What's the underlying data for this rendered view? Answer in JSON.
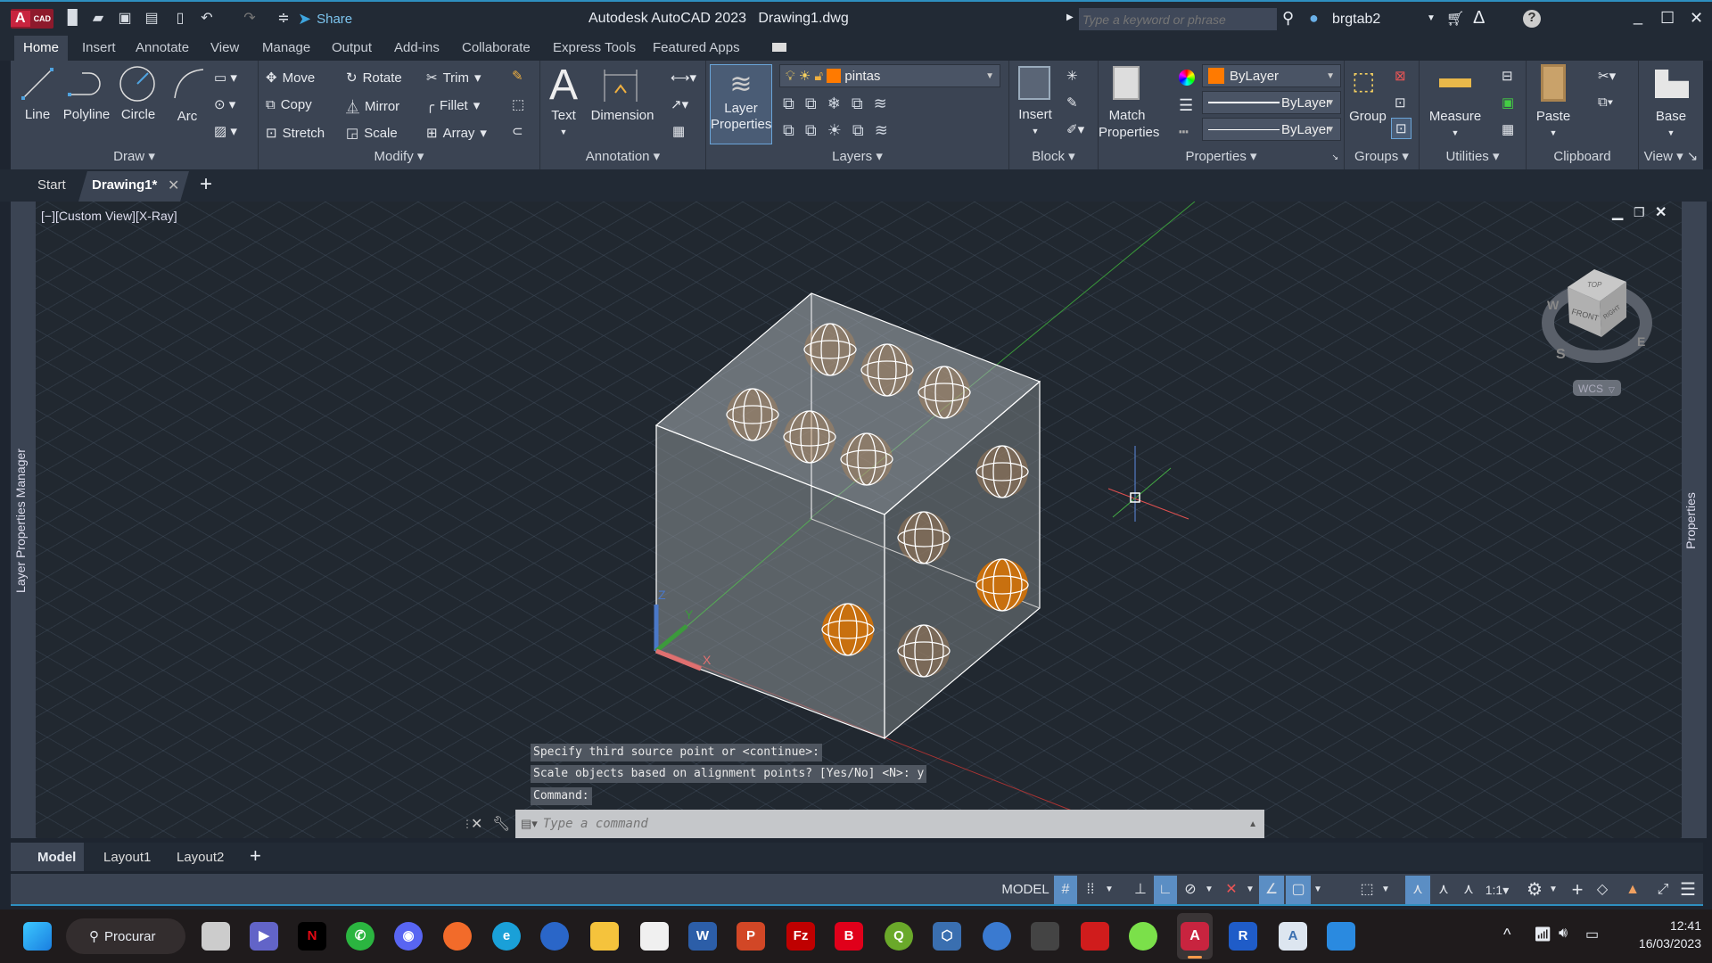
{
  "titlebar": {
    "app_logo": "A CAD",
    "share": "Share",
    "title": "Autodesk AutoCAD 2023",
    "file": "Drawing1.dwg",
    "search_placeholder": "Type a keyword or phrase",
    "user": "brgtab2"
  },
  "ribbon_tabs": [
    "Home",
    "Insert",
    "Annotate",
    "View",
    "Manage",
    "Output",
    "Add-ins",
    "Collaborate",
    "Express Tools",
    "Featured Apps"
  ],
  "ribbon": {
    "draw": {
      "label": "Draw",
      "tools": [
        "Line",
        "Polyline",
        "Circle",
        "Arc"
      ]
    },
    "modify": {
      "label": "Modify",
      "tools": [
        "Move",
        "Rotate",
        "Trim",
        "Copy",
        "Mirror",
        "Fillet",
        "Stretch",
        "Scale",
        "Array"
      ]
    },
    "annotation": {
      "label": "Annotation",
      "tools": [
        "Text",
        "Dimension"
      ]
    },
    "layers": {
      "label": "Layers",
      "layer_properties": "Layer",
      "layer_properties2": "Properties",
      "current_layer": "pintas",
      "layer_color": "#ff7a00"
    },
    "block": {
      "label": "Block",
      "insert": "Insert"
    },
    "properties": {
      "label": "Properties",
      "match1": "Match",
      "match2": "Properties",
      "color": "ByLayer",
      "linetype": "ByLayer",
      "lineweight": "ByLayer"
    },
    "groups": {
      "label": "Groups",
      "group": "Group"
    },
    "utilities": {
      "label": "Utilities",
      "measure": "Measure"
    },
    "clipboard": {
      "label": "Clipboard",
      "paste": "Paste"
    },
    "view": {
      "label": "View",
      "base": "Base"
    }
  },
  "doc_tabs": {
    "start": "Start",
    "active": "Drawing1*"
  },
  "viewport": {
    "label": "[−][Custom View][X-Ray]",
    "viewcube": {
      "top": "TOP",
      "front": "FRONT",
      "right": "RIGHT",
      "n": "N",
      "w": "W",
      "s": "S",
      "e": "E",
      "ucs": "WCS"
    },
    "ucs_axes": {
      "x": "X",
      "y": "Y",
      "z": "Z"
    }
  },
  "side_palettes": {
    "left": "Layer Properties Manager",
    "right": "Properties"
  },
  "command": {
    "history": [
      "Specify third source point or <continue>:",
      "Scale objects based on alignment points? [Yes/No] <N>: y",
      "Command:"
    ],
    "placeholder": "Type a command"
  },
  "layout_tabs": [
    "Model",
    "Layout1",
    "Layout2"
  ],
  "statusbar": {
    "model": "MODEL",
    "scale": "1:1"
  },
  "taskbar": {
    "search": "Procurar",
    "time": "12:41",
    "date": "16/03/2023"
  },
  "colors": {
    "accent": "#2e8fc0",
    "solid_pip": "#c8700f",
    "ribbon": "#3b4453"
  }
}
